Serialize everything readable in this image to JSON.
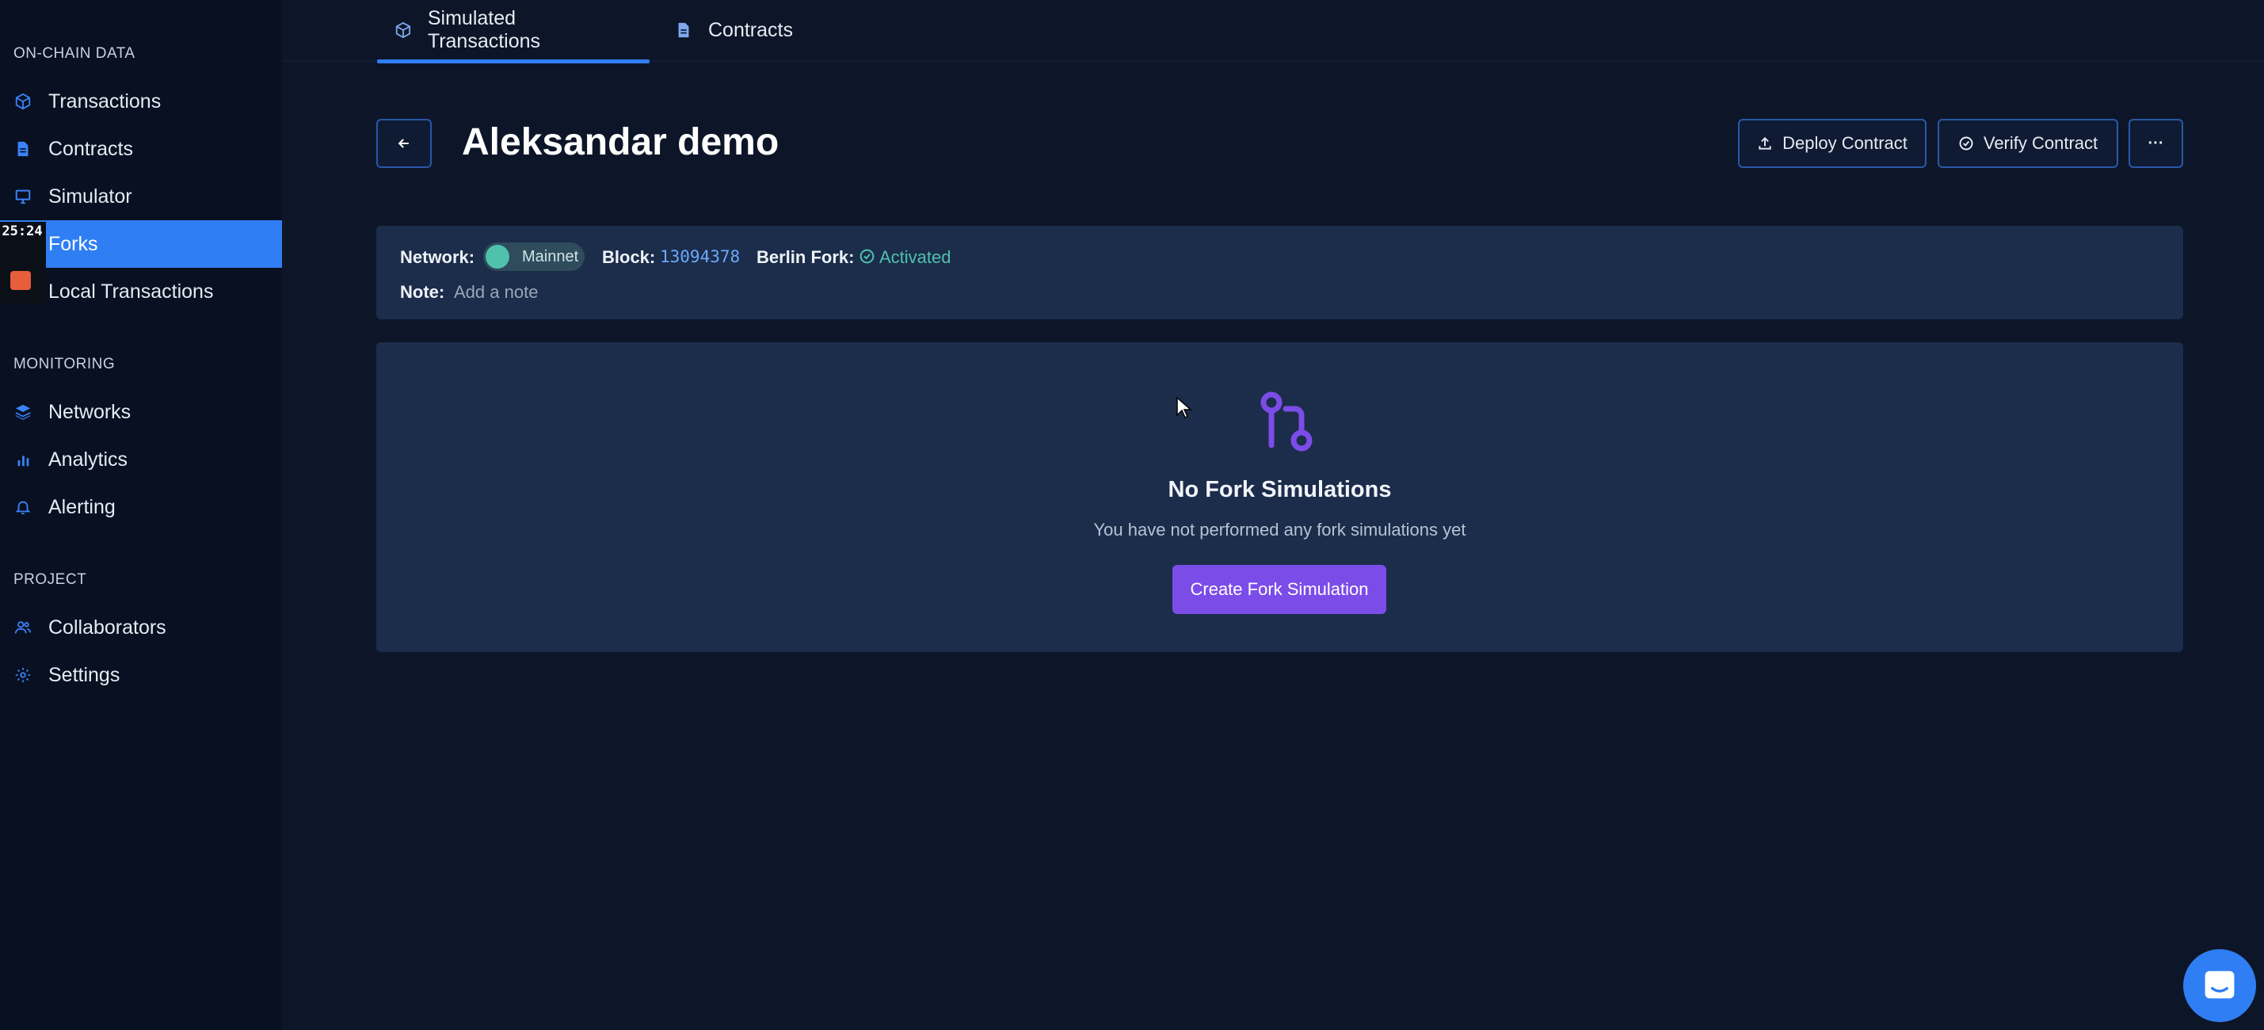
{
  "sidebar": {
    "sections": [
      {
        "title": "ON-CHAIN DATA"
      },
      {
        "title": "MONITORING"
      },
      {
        "title": "PROJECT"
      }
    ],
    "items": [
      {
        "label": "Transactions",
        "icon": "cube-icon"
      },
      {
        "label": "Contracts",
        "icon": "document-icon"
      },
      {
        "label": "Simulator",
        "icon": "monitor-icon"
      },
      {
        "label": "Forks",
        "icon": "fork-icon",
        "active": true
      },
      {
        "label": "Local Transactions",
        "icon": "terminal-icon"
      },
      {
        "label": "Networks",
        "icon": "layers-icon"
      },
      {
        "label": "Analytics",
        "icon": "bar-chart-icon"
      },
      {
        "label": "Alerting",
        "icon": "bell-icon"
      },
      {
        "label": "Collaborators",
        "icon": "users-icon"
      },
      {
        "label": "Settings",
        "icon": "gear-icon"
      }
    ]
  },
  "recording": {
    "time": "25:24"
  },
  "tabs": [
    {
      "label": "Simulated Transactions",
      "icon": "cube-icon",
      "active": true
    },
    {
      "label": "Contracts",
      "icon": "document-icon"
    }
  ],
  "header": {
    "title": "Aleksandar demo",
    "deploy_label": "Deploy Contract",
    "verify_label": "Verify Contract",
    "more_label": "···"
  },
  "info": {
    "network_key": "Network:",
    "network_value": "Mainnet",
    "block_key": "Block:",
    "block_value": "13094378",
    "berlin_key": "Berlin Fork:",
    "berlin_value": "Activated",
    "note_key": "Note:",
    "note_value": "Add a note"
  },
  "empty": {
    "title": "No Fork Simulations",
    "subtitle": "You have not performed any fork simulations yet",
    "button": "Create Fork Simulation"
  },
  "colors": {
    "accent": "#2f7ef4",
    "primary_button": "#7c4ce8",
    "success": "#4fc1ad",
    "block_link": "#6ea8ff"
  }
}
